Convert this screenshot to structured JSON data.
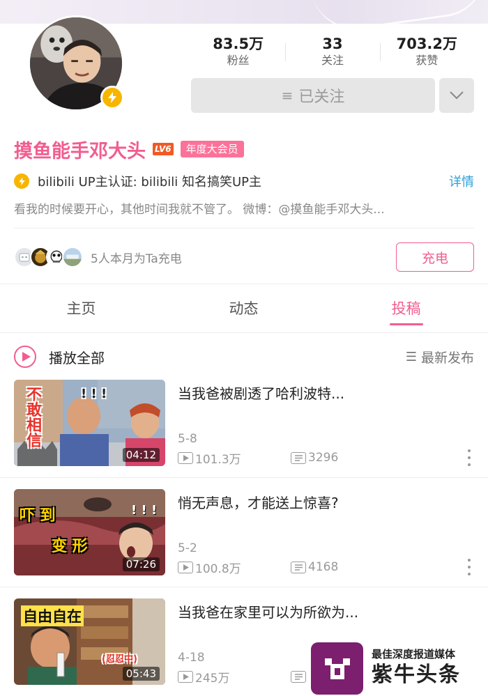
{
  "profile": {
    "name": "摸鱼能手邓大头",
    "level": "LV6",
    "vip_label": "年度大会员",
    "verification": "bilibili UP主认证: bilibili 知名搞笑UP主",
    "detail_label": "详情",
    "bio": "看我的时候要开心，其他时间我就不管了。 微博：@摸鱼能手邓大头...",
    "accent_color": "#f25d8e",
    "verify_color": "#f7b500"
  },
  "stats": [
    {
      "value": "83.5万",
      "label": "粉丝"
    },
    {
      "value": "33",
      "label": "关注"
    },
    {
      "value": "703.2万",
      "label": "获赞"
    }
  ],
  "follow": {
    "label": "已关注",
    "icon": "menu-icon",
    "more_icon": "chevron-down-icon"
  },
  "charge": {
    "text": "5人本月为Ta充电",
    "button": "充电"
  },
  "tabs": [
    {
      "label": "主页",
      "active": false
    },
    {
      "label": "动态",
      "active": false
    },
    {
      "label": "投稿",
      "active": true
    }
  ],
  "play_all": {
    "label": "播放全部",
    "sort_label": "最新发布"
  },
  "videos": [
    {
      "title": "当我爸被剧透了哈利波特...",
      "date": "5-8",
      "views": "101.3万",
      "danmaku": "3296",
      "duration": "04:12",
      "thumb_text": [
        "不",
        "敢",
        "相",
        "信"
      ],
      "thumb_excl": "! ! !"
    },
    {
      "title": "悄无声息，才能送上惊喜?",
      "date": "5-2",
      "views": "100.8万",
      "danmaku": "4168",
      "duration": "07:26",
      "thumb_text": [
        "吓 到",
        "变 形"
      ],
      "thumb_excl": "! ! !"
    },
    {
      "title": "当我爸在家里可以为所欲为...",
      "date": "4-18",
      "views": "245万",
      "danmaku": "",
      "duration": "05:43",
      "thumb_text": [
        "自由自在",
        "(忍忍中)"
      ]
    }
  ],
  "watermark": {
    "small": "最佳深度报道媒体",
    "big": "紫牛头条",
    "color": "#7b1f6e"
  }
}
